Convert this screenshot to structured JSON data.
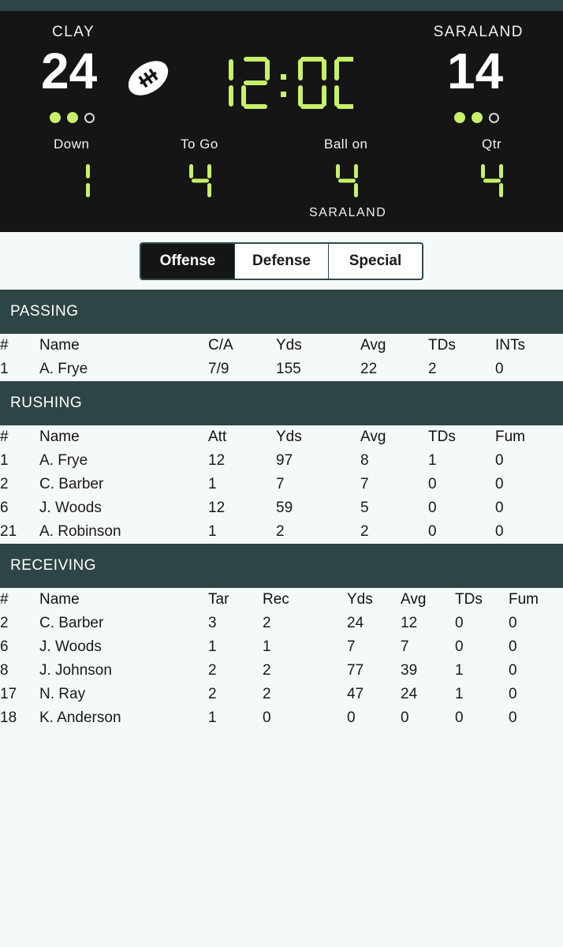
{
  "scoreboard": {
    "home": {
      "name": "CLAY",
      "score": "24",
      "timeouts_remaining": 2,
      "timeouts_total": 3
    },
    "away": {
      "name": "SARALAND",
      "score": "14",
      "timeouts_remaining": 2,
      "timeouts_total": 3
    },
    "clock": "12:00",
    "down_label": "Down",
    "down": "1",
    "togo_label": "To Go",
    "togo": "4",
    "ballon_label": "Ball on",
    "ballon": "4",
    "ballon_team": "SARALAND",
    "qtr_label": "Qtr",
    "qtr": "4",
    "digit_color": "#c8f06a",
    "possession_icon": "football-icon"
  },
  "tabs": [
    {
      "label": "Offense",
      "active": true
    },
    {
      "label": "Defense",
      "active": false
    },
    {
      "label": "Special",
      "active": false
    }
  ],
  "passing": {
    "title": "PASSING",
    "headers": [
      "#",
      "Name",
      "C/A",
      "Yds",
      "Avg",
      "TDs",
      "INTs"
    ],
    "rows": [
      [
        "1",
        "A. Frye",
        "7/9",
        "155",
        "22",
        "2",
        "0"
      ]
    ]
  },
  "rushing": {
    "title": "RUSHING",
    "headers": [
      "#",
      "Name",
      "Att",
      "Yds",
      "Avg",
      "TDs",
      "Fum"
    ],
    "rows": [
      [
        "1",
        "A. Frye",
        "12",
        "97",
        "8",
        "1",
        "0"
      ],
      [
        "2",
        "C. Barber",
        "1",
        "7",
        "7",
        "0",
        "0"
      ],
      [
        "6",
        "J. Woods",
        "12",
        "59",
        "5",
        "0",
        "0"
      ],
      [
        "21",
        "A. Robinson",
        "1",
        "2",
        "2",
        "0",
        "0"
      ]
    ]
  },
  "receiving": {
    "title": "RECEIVING",
    "headers": [
      "#",
      "Name",
      "Tar",
      "Rec",
      "Yds",
      "Avg",
      "TDs",
      "Fum"
    ],
    "rows": [
      [
        "2",
        "C. Barber",
        "3",
        "2",
        "24",
        "12",
        "0",
        "0"
      ],
      [
        "6",
        "J. Woods",
        "1",
        "1",
        "7",
        "7",
        "0",
        "0"
      ],
      [
        "8",
        "J. Johnson",
        "2",
        "2",
        "77",
        "39",
        "1",
        "0"
      ],
      [
        "17",
        "N. Ray",
        "2",
        "2",
        "47",
        "24",
        "1",
        "0"
      ],
      [
        "18",
        "K. Anderson",
        "1",
        "0",
        "0",
        "0",
        "0",
        "0"
      ]
    ]
  },
  "colors": {
    "header_bg": "#2d4544",
    "board_bg": "#151515",
    "page_bg": "#f4f9f9"
  }
}
